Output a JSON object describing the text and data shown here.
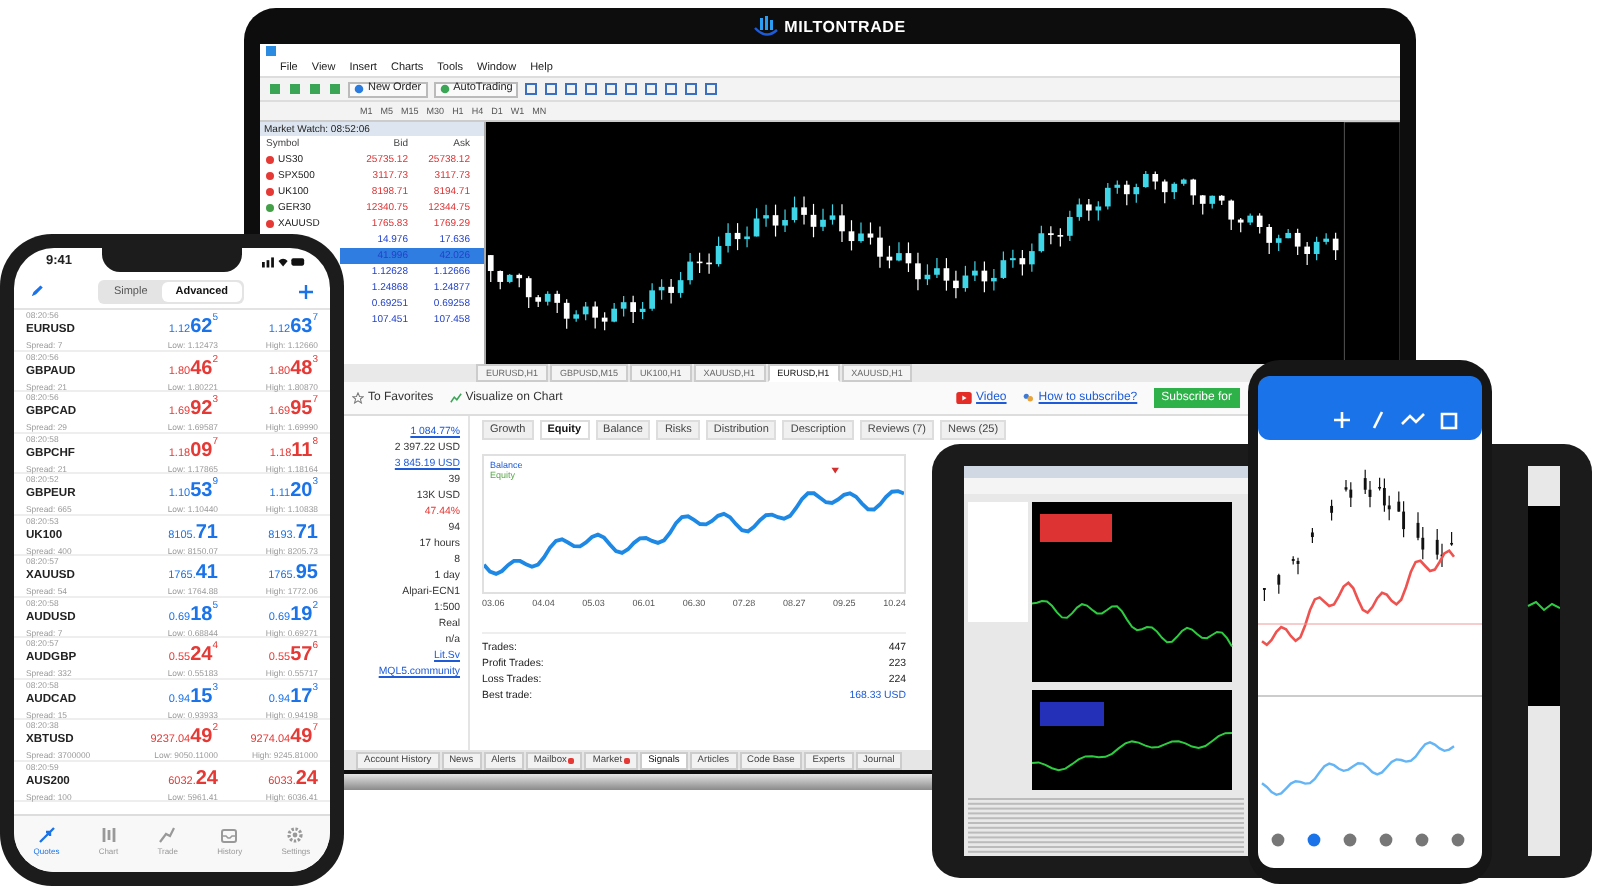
{
  "brand": {
    "name": "MILTONTRADE"
  },
  "terminal": {
    "menu": [
      "File",
      "View",
      "Insert",
      "Charts",
      "Tools",
      "Window",
      "Help"
    ],
    "toolbar_buttons": [
      "New Order",
      "AutoTrading"
    ],
    "timeframes": [
      "M1",
      "M5",
      "M15",
      "M30",
      "H1",
      "H4",
      "D1",
      "W1",
      "MN"
    ],
    "market_watch": {
      "title": "Market Watch: 08:52:06",
      "columns": [
        "Symbol",
        "Bid",
        "Ask"
      ],
      "rows": [
        {
          "symbol": "US30",
          "color": "#e53935",
          "bid": "25735.12",
          "ask": "25738.12",
          "selected": false
        },
        {
          "symbol": "SPX500",
          "color": "#e53935",
          "bid": "3117.73",
          "ask": "3117.73",
          "selected": false
        },
        {
          "symbol": "UK100",
          "color": "#e53935",
          "bid": "8198.71",
          "ask": "8194.71",
          "selected": false
        },
        {
          "symbol": "GER30",
          "color": "#43a047",
          "bid": "12340.75",
          "ask": "12344.75",
          "selected": false
        },
        {
          "symbol": "XAUUSD",
          "color": "#e53935",
          "bid": "1765.83",
          "ask": "1769.29",
          "selected": false
        },
        {
          "bid": "14.976",
          "ask": "17.636",
          "selected": false
        },
        {
          "bid": "41.996",
          "ask": "42.026",
          "selected": true
        },
        {
          "bid": "1.12628",
          "ask": "1.12666",
          "selected": false
        },
        {
          "bid": "1.24868",
          "ask": "1.24877",
          "selected": false
        },
        {
          "bid": "0.69251",
          "ask": "0.69258",
          "selected": false
        },
        {
          "bid": "107.451",
          "ask": "107.458",
          "selected": false
        }
      ]
    },
    "chart_tabs": [
      {
        "label": "EURUSD,H1",
        "selected": false
      },
      {
        "label": "GBPUSD,M15",
        "selected": false
      },
      {
        "label": "UK100,H1",
        "selected": false
      },
      {
        "label": "XAUUSD,H1",
        "selected": false
      },
      {
        "label": "EURUSD,H1",
        "selected": true
      },
      {
        "label": "XAUUSD,H1",
        "selected": false
      }
    ],
    "signal": {
      "actions": [
        "To Favorites",
        "Visualize on Chart"
      ],
      "links": [
        "Video",
        "How to subscribe?"
      ],
      "subscribe_button": "Subscribe for",
      "stats": [
        {
          "text": "1 084.77%",
          "kind": "link"
        },
        {
          "text": "2 397.22 USD",
          "kind": "plain"
        },
        {
          "text": "3 845.19 USD",
          "kind": "link"
        },
        {
          "text": "39",
          "kind": "plain"
        },
        {
          "text": "13K USD",
          "kind": "plain"
        },
        {
          "text": "47.44%",
          "kind": "negative"
        },
        {
          "text": "94",
          "kind": "plain"
        },
        {
          "text": "17 hours",
          "kind": "plain"
        },
        {
          "text": "8",
          "kind": "plain"
        },
        {
          "text": "1 day",
          "kind": "plain"
        },
        {
          "text": "Alpari-ECN1",
          "kind": "plain"
        },
        {
          "text": "1:500",
          "kind": "plain"
        },
        {
          "text": "Real",
          "kind": "plain"
        },
        {
          "text": "n/a",
          "kind": "plain"
        },
        {
          "text": "Lit.Sv",
          "kind": "link"
        },
        {
          "text": "MQL5.community",
          "kind": "link"
        }
      ],
      "tabs": [
        {
          "label": "Growth",
          "selected": false
        },
        {
          "label": "Equity",
          "selected": true
        },
        {
          "label": "Balance",
          "selected": false
        },
        {
          "label": "Risks",
          "selected": false
        },
        {
          "label": "Distribution",
          "selected": false
        },
        {
          "label": "Description",
          "selected": false
        },
        {
          "label": "Reviews (7)",
          "selected": false
        },
        {
          "label": "News (25)",
          "selected": false
        }
      ],
      "legend": [
        "Balance",
        "Equity"
      ],
      "x_labels": [
        "03.06",
        "04.04",
        "05.03",
        "06.01",
        "06.30",
        "07.28",
        "08.27",
        "09.25",
        "10.24"
      ],
      "summary": [
        {
          "label": "Trades:",
          "value": "447"
        },
        {
          "label": "Profit Trades:",
          "value": "223"
        },
        {
          "label": "Loss Trades:",
          "value": "224"
        },
        {
          "label": "Best trade:",
          "value": "168.33 USD"
        }
      ]
    },
    "bottom_tabs": [
      {
        "label": "Account History",
        "selected": false,
        "badge": false
      },
      {
        "label": "News",
        "selected": false,
        "badge": false
      },
      {
        "label": "Alerts",
        "selected": false,
        "badge": false
      },
      {
        "label": "Mailbox",
        "selected": false,
        "badge": true
      },
      {
        "label": "Market",
        "selected": false,
        "badge": true
      },
      {
        "label": "Signals",
        "selected": true,
        "badge": false
      },
      {
        "label": "Articles",
        "selected": false,
        "badge": false
      },
      {
        "label": "Code Base",
        "selected": false,
        "badge": false
      },
      {
        "label": "Experts",
        "selected": false,
        "badge": false
      },
      {
        "label": "Journal",
        "selected": false,
        "badge": false
      }
    ]
  },
  "phone": {
    "time": "9:41",
    "segments": [
      {
        "label": "Simple",
        "selected": false
      },
      {
        "label": "Advanced",
        "selected": true
      }
    ],
    "quotes": [
      {
        "time": "08:20:56",
        "symbol": "EURUSD",
        "spread": "Spread: 7",
        "color": "#1a73e8",
        "bid": {
          "small": "1.12",
          "big": "62",
          "sup": "5"
        },
        "ask": {
          "small": "1.12",
          "big": "63",
          "sup": "7"
        },
        "low": "Low: 1.12473",
        "high": "High: 1.12660"
      },
      {
        "time": "08:20:56",
        "symbol": "GBPAUD",
        "spread": "Spread: 21",
        "color": "#e53935",
        "bid": {
          "small": "1.80",
          "big": "46",
          "sup": "2"
        },
        "ask": {
          "small": "1.80",
          "big": "48",
          "sup": "3"
        },
        "low": "Low: 1.80221",
        "high": "High: 1.80870"
      },
      {
        "time": "08:20:56",
        "symbol": "GBPCAD",
        "spread": "Spread: 29",
        "color": "#e53935",
        "bid": {
          "small": "1.69",
          "big": "92",
          "sup": "3"
        },
        "ask": {
          "small": "1.69",
          "big": "95",
          "sup": "7"
        },
        "low": "Low: 1.69587",
        "high": "High: 1.69990"
      },
      {
        "time": "08:20:58",
        "symbol": "GBPCHF",
        "spread": "Spread: 21",
        "color": "#e53935",
        "bid": {
          "small": "1.18",
          "big": "09",
          "sup": "7"
        },
        "ask": {
          "small": "1.18",
          "big": "11",
          "sup": "8"
        },
        "low": "Low: 1.17865",
        "high": "High: 1.18164"
      },
      {
        "time": "08:20:52",
        "symbol": "GBPEUR",
        "spread": "Spread: 665",
        "color": "#1a73e8",
        "bid": {
          "small": "1.10",
          "big": "53",
          "sup": "9"
        },
        "ask": {
          "small": "1.11",
          "big": "20",
          "sup": "3"
        },
        "low": "Low: 1.10440",
        "high": "High: 1.10838"
      },
      {
        "time": "08:20:53",
        "symbol": "UK100",
        "spread": "Spread: 400",
        "color": "#1a73e8",
        "bid": {
          "small": "8105.",
          "big": "71"
        },
        "ask": {
          "small": "8193.",
          "big": "71"
        },
        "low": "Low: 8150.07",
        "high": "High: 8205.73"
      },
      {
        "time": "08:20:57",
        "symbol": "XAUUSD",
        "spread": "Spread: 54",
        "color": "#1a73e8",
        "bid": {
          "small": "1765.",
          "big": "41"
        },
        "ask": {
          "small": "1765.",
          "big": "95"
        },
        "low": "Low: 1764.88",
        "high": "High: 1772.06"
      },
      {
        "time": "08:20:58",
        "symbol": "AUDUSD",
        "spread": "Spread: 7",
        "color": "#1a73e8",
        "bid": {
          "small": "0.69",
          "big": "18",
          "sup": "5"
        },
        "ask": {
          "small": "0.69",
          "big": "19",
          "sup": "2"
        },
        "low": "Low: 0.68844",
        "high": "High: 0.69271"
      },
      {
        "time": "08:20:57",
        "symbol": "AUDGBP",
        "spread": "Spread: 332",
        "color": "#e53935",
        "bid": {
          "small": "0.55",
          "big": "24",
          "sup": "4"
        },
        "ask": {
          "small": "0.55",
          "big": "57",
          "sup": "6"
        },
        "low": "Low: 0.55183",
        "high": "High: 0.55717"
      },
      {
        "time": "08:20:58",
        "symbol": "AUDCAD",
        "spread": "Spread: 15",
        "color": "#1a73e8",
        "bid": {
          "small": "0.94",
          "big": "15",
          "sup": "3"
        },
        "ask": {
          "small": "0.94",
          "big": "17",
          "sup": "3"
        },
        "low": "Low: 0.93933",
        "high": "High: 0.94198"
      },
      {
        "time": "08:20:38",
        "symbol": "XBTUSD",
        "spread": "Spread: 3700000",
        "color": "#e53935",
        "bid": {
          "small": "9237.04",
          "big": "49",
          "sup": "2"
        },
        "ask": {
          "small": "9274.04",
          "big": "49",
          "sup": "7"
        },
        "low": "Low: 9050.11000",
        "high": "High: 9245.81000"
      },
      {
        "time": "08:20:59",
        "symbol": "AUS200",
        "spread": "Spread: 100",
        "color": "#e53935",
        "bid": {
          "small": "6032.",
          "big": "24"
        },
        "ask": {
          "small": "6033.",
          "big": "24"
        },
        "low": "Low: 5961.41",
        "high": "High: 6036.41"
      }
    ],
    "tabs": [
      {
        "label": "Quotes",
        "selected": true
      },
      {
        "label": "Chart",
        "selected": false
      },
      {
        "label": "Trade",
        "selected": false
      },
      {
        "label": "History",
        "selected": false
      },
      {
        "label": "Settings",
        "selected": false
      }
    ]
  }
}
